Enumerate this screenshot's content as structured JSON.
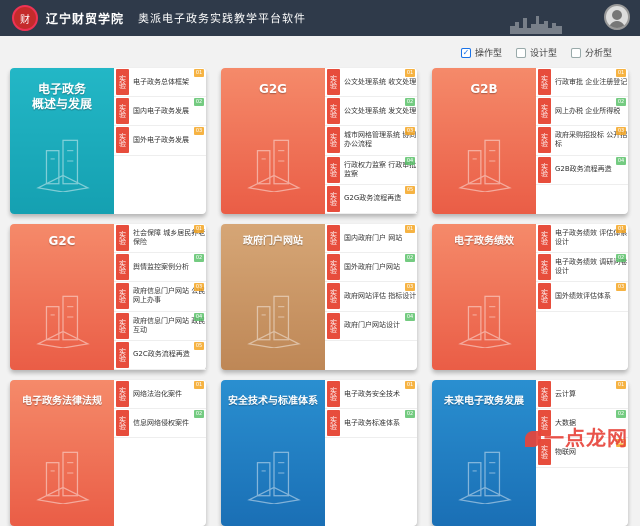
{
  "header": {
    "logo_text": "财",
    "school": "辽宁财贸学院",
    "app_title": "奥派电子政务实践教学平台软件"
  },
  "filters": [
    {
      "label": "操作型",
      "checked": true
    },
    {
      "label": "设计型",
      "checked": false
    },
    {
      "label": "分析型",
      "checked": false
    }
  ],
  "colors": {
    "teal": "#1aa8b8",
    "coral": "#ee7156",
    "tan": "#c99464",
    "red_tag": "#e74d3c",
    "green_num": "#5cc36c"
  },
  "cards": [
    {
      "title": [
        "电子政务",
        "概述与发展"
      ],
      "theme": "teal",
      "icon": "city-buildings-icon",
      "items": [
        {
          "tag": "实验",
          "label": "电子政务总体框架",
          "num": "01"
        },
        {
          "tag": "实验",
          "label": "国内电子政务发展",
          "num": "02"
        },
        {
          "tag": "实验",
          "label": "国外电子政务发展",
          "num": "03"
        }
      ]
    },
    {
      "title": [
        "G2G"
      ],
      "theme": "coral",
      "icon": "office-building-icon",
      "items": [
        {
          "tag": "实验",
          "label": "公文处理系统 收文处理",
          "num": "01"
        },
        {
          "tag": "实验",
          "label": "公文处理系统 发文处理",
          "num": "02"
        },
        {
          "tag": "实验",
          "label": "城市网格管理系统 协同办公流程",
          "num": "03"
        },
        {
          "tag": "实验",
          "label": "行政权力监察 行政审批监察",
          "num": "04"
        },
        {
          "tag": "实验",
          "label": "G2G政务流程再造",
          "num": "05"
        }
      ]
    },
    {
      "title": [
        "G2B"
      ],
      "theme": "coral",
      "icon": "skyscraper-icon",
      "items": [
        {
          "tag": "实验",
          "label": "行政审批 企业注册登记",
          "num": "01"
        },
        {
          "tag": "实验",
          "label": "网上办税 企业所得税",
          "num": "02"
        },
        {
          "tag": "实验",
          "label": "政府采购招投标 公开招标",
          "num": "03"
        },
        {
          "tag": "实验",
          "label": "G2B政务流程再造",
          "num": "04"
        }
      ]
    },
    {
      "title": [
        "G2C"
      ],
      "theme": "coral",
      "icon": "service-desk-icon",
      "items": [
        {
          "tag": "实验",
          "label": "社会保障 城乡居民养老保险",
          "num": "01"
        },
        {
          "tag": "实验",
          "label": "舆情监控案例分析",
          "num": "02"
        },
        {
          "tag": "实验",
          "label": "政府信息门户网站 公民网上办事",
          "num": "03"
        },
        {
          "tag": "实验",
          "label": "政府信息门户网站 政民互动",
          "num": "04"
        },
        {
          "tag": "实验",
          "label": "G2C政务流程再造",
          "num": "05"
        }
      ]
    },
    {
      "title": [
        "政府门户网站"
      ],
      "theme": "tan",
      "icon": "portal-screen-icon",
      "items": [
        {
          "tag": "实验",
          "label": "国内政府门户 网站",
          "num": "01"
        },
        {
          "tag": "实验",
          "label": "国外政府门户网站",
          "num": "02"
        },
        {
          "tag": "实验",
          "label": "政府网站评估 指标设计",
          "num": "03"
        },
        {
          "tag": "实验",
          "label": "政府门户网站设计",
          "num": "04"
        }
      ]
    },
    {
      "title": [
        "电子政务绩效"
      ],
      "theme": "coral",
      "icon": "survey-board-icon",
      "items": [
        {
          "tag": "实验",
          "label": "电子政务绩效 评估体系设计",
          "num": "01"
        },
        {
          "tag": "实验",
          "label": "电子政务绩效 调研问卷设计",
          "num": "02"
        },
        {
          "tag": "实验",
          "label": "国外绩效评估体系",
          "num": "03"
        }
      ]
    },
    {
      "title": [
        "电子政务法律法规"
      ],
      "theme": "coral",
      "icon": "tower-icon",
      "items": [
        {
          "tag": "实验",
          "label": "网络法治化案件",
          "num": "01"
        },
        {
          "tag": "实验",
          "label": "信息网络侵权案件",
          "num": "02"
        }
      ]
    },
    {
      "title": [
        "安全技术与标准体系"
      ],
      "theme": "blue",
      "icon": "shield-icon",
      "items": [
        {
          "tag": "实验",
          "label": "电子政务安全技术",
          "num": "01"
        },
        {
          "tag": "实验",
          "label": "电子政务标准体系",
          "num": "02"
        }
      ]
    },
    {
      "title": [
        "未来电子政务发展"
      ],
      "theme": "blue",
      "icon": "future-city-icon",
      "items": [
        {
          "tag": "实验",
          "label": "云计算",
          "num": "01"
        },
        {
          "tag": "实验",
          "label": "大数据",
          "num": "02"
        },
        {
          "tag": "实验",
          "label": "物联网",
          "num": "03"
        }
      ]
    }
  ],
  "watermark": "一点龙网"
}
